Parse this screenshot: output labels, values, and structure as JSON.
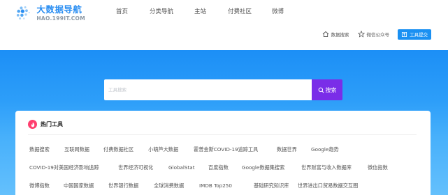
{
  "logo": {
    "title": "大数据导航",
    "subtitle": "HAO.199IT.COM"
  },
  "nav": {
    "items": [
      "首页",
      "分类导航",
      "主站",
      "付费社区",
      "微博"
    ]
  },
  "sub_actions": {
    "data_search": "数据搜索",
    "wechat": "微信公众号",
    "submit_tool": "工具提交"
  },
  "search": {
    "placeholder": "工具搜索",
    "button_label": "搜索"
  },
  "hot_tools": {
    "title": "热门工具",
    "rows": [
      [
        "数据搜索",
        "互联网数据",
        "付费数据社区",
        "小萌芦大数据",
        "霍普金斯COVID-19追踪工具",
        "数据世界",
        "Google趋势"
      ],
      [
        "COVID-19对美国经济影响追踪",
        "世界经济可视化",
        "GlobalStat",
        "百度指数",
        "Google数据集搜索",
        "世界财富与收入数据库",
        "微信指数"
      ],
      [
        "微博指数",
        "中国国家数据",
        "世界银行数据",
        "全球消费数据",
        "IMDB Top250",
        "基础研究知识库",
        "世界进出口贸易数据交互图"
      ]
    ]
  },
  "colors": {
    "brand_blue": "#1a90f2",
    "search_button": "#7a2de8",
    "hot_badge": "#ff3f6f"
  }
}
